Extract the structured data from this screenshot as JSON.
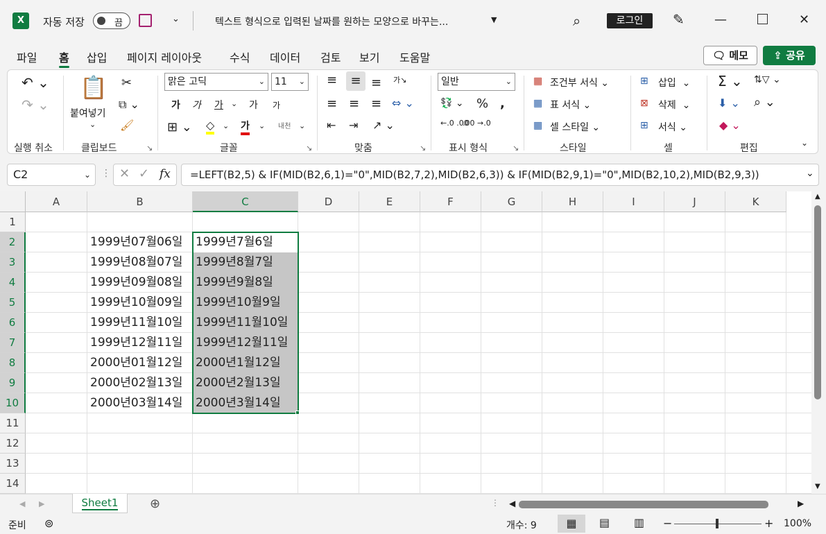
{
  "titlebar": {
    "app_icon": "X",
    "autosave_label": "자동 저장",
    "toggle_state": "끔",
    "doc_title": "텍스트 형식으로 입력된 날짜를 원하는 모양으로 바꾸는...",
    "login": "로그인"
  },
  "tabs": [
    "파일",
    "홈",
    "삽입",
    "페이지 레이아웃",
    "수식",
    "데이터",
    "검토",
    "보기",
    "도움말"
  ],
  "active_tab": "홈",
  "memo_button": "메모",
  "share_button": "공유",
  "ribbon": {
    "undo_group": "실행 취소",
    "clipboard_group": "클립보드",
    "paste_label": "붙여넣기",
    "font_group": "글꼴",
    "font_name": "맑은 고딕",
    "font_size": "11",
    "bold": "가",
    "italic": "가",
    "underline": "가",
    "grow": "가",
    "shrink": "가",
    "font_color_glyph": "가",
    "hanja": "내천",
    "align_group": "맞춤",
    "number_group": "표시 형식",
    "number_format": "일반",
    "styles_group": "스타일",
    "cond_format": "조건부 서식",
    "table_format": "표 서식",
    "cell_styles": "셀 스타일",
    "cells_group": "셀",
    "insert": "삽입",
    "delete": "삭제",
    "format": "서식",
    "edit_group": "편집"
  },
  "formula_bar": {
    "name_box": "C2",
    "fx": "fx",
    "formula": "=LEFT(B2,5) & IF(MID(B2,6,1)=\"0\",MID(B2,7,2),MID(B2,6,3)) & IF(MID(B2,9,1)=\"0\",MID(B2,10,2),MID(B2,9,3))"
  },
  "columns": [
    "A",
    "B",
    "C",
    "D",
    "E",
    "F",
    "G",
    "H",
    "I",
    "J",
    "K"
  ],
  "rows": [
    "1",
    "2",
    "3",
    "4",
    "5",
    "6",
    "7",
    "8",
    "9",
    "10",
    "11",
    "12",
    "13",
    "14"
  ],
  "column_b": [
    "1999년07월06일",
    "1999년08월07일",
    "1999년09월08일",
    "1999년10월09일",
    "1999년11월10일",
    "1999년12월11일",
    "2000년01월12일",
    "2000년02월13일",
    "2000년03월14일"
  ],
  "column_c": [
    "1999년7월6일",
    "1999년8월7일",
    "1999년9월8일",
    "1999년10월9일",
    "1999년11월10일",
    "1999년12월11일",
    "2000년1월12일",
    "2000년2월13일",
    "2000년3월14일"
  ],
  "sheet_tab": "Sheet1",
  "status": {
    "ready": "준비",
    "count": "개수: 9",
    "zoom": "100%"
  },
  "colors": {
    "accent": "#107c41",
    "selection": "#c6c6c6"
  }
}
